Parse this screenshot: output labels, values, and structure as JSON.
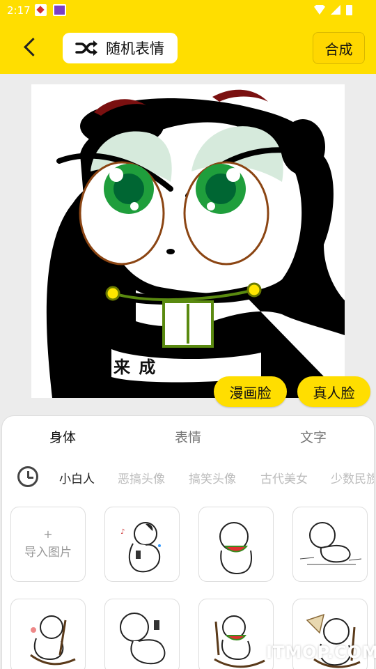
{
  "status_bar": {
    "time": "2:17",
    "icons": [
      "app-notification-icon",
      "app-notification-icon",
      "wifi-icon",
      "signal-icon",
      "battery-icon"
    ]
  },
  "toolbar": {
    "back_icon": "chevron-left-icon",
    "random_icon": "shuffle-icon",
    "random_label": "随机表情",
    "compose_label": "合成"
  },
  "canvas": {
    "caption": "来              成",
    "cartoon_face_label": "漫画脸",
    "real_face_label": "真人脸"
  },
  "sheet": {
    "tabs": [
      {
        "label": "身体",
        "active": true
      },
      {
        "label": "表情",
        "active": false
      },
      {
        "label": "文字",
        "active": false
      }
    ],
    "history_icon": "clock-icon",
    "categories": [
      {
        "label": "小白人",
        "active": true
      },
      {
        "label": "恶搞头像",
        "active": false
      },
      {
        "label": "搞笑头像",
        "active": false
      },
      {
        "label": "古代美女",
        "active": false
      },
      {
        "label": "少数民族",
        "active": false
      }
    ],
    "import": {
      "plus": "+",
      "label": "导入图片"
    },
    "items": [
      "sticker-figure-phone",
      "sticker-figure-watermelon",
      "sticker-figure-sitting",
      "sticker-figure-rocking-chair",
      "sticker-figure-phone-lying",
      "sticker-figure-rocking-chair-watermelon",
      "sticker-figure-fan"
    ]
  },
  "watermark": "ITMOP.COM",
  "colors": {
    "accent": "#ffde00",
    "background": "#ececec"
  }
}
